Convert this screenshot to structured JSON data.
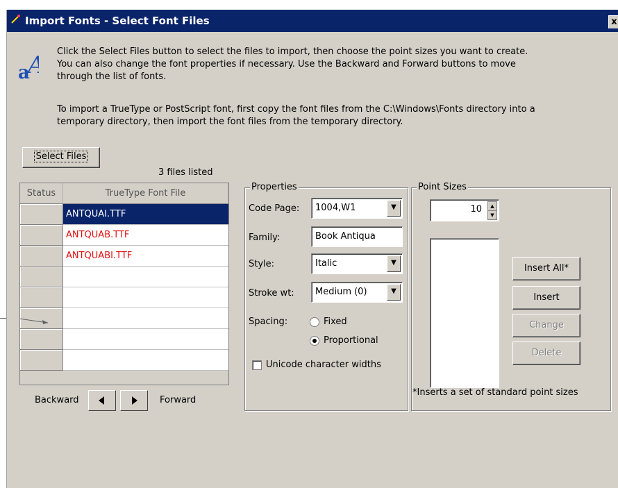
{
  "window": {
    "title": "Import Fonts - Select Font Files",
    "close_label": "x"
  },
  "instructions": {
    "line1": "Click the Select Files button to select the files to import, then choose the point sizes you want to create.",
    "line2": "You can also change the font properties if necessary. Use the Backward and Forward buttons to move",
    "line3": "through the list of fonts.",
    "line4": "To import a TrueType or PostScript font, first copy the font files from the C:\\Windows\\Fonts directory into a",
    "line5": "temporary directory, then import the font files from the temporary directory."
  },
  "select_files_label": "Select Files",
  "files_count": "3 files listed",
  "table": {
    "columns": [
      "Status",
      "TrueType Font File"
    ],
    "rows": [
      "ANTQUAI.TTF",
      "ANTQUAB.TTF",
      "ANTQUABI.TTF",
      "",
      "",
      "",
      "",
      ""
    ]
  },
  "navigation": {
    "backward_label": "Backward",
    "forward_label": "Forward"
  },
  "properties": {
    "group_label": "Properties",
    "code_page_label": "Code Page:",
    "code_page_value": "1004,W1",
    "family_label": "Family:",
    "family_value": "Book Antiqua",
    "style_label": "Style:",
    "style_value": "Italic",
    "stroke_label": "Stroke wt:",
    "stroke_value": "Medium (0)",
    "spacing_label": "Spacing:",
    "fixed_label": "Fixed",
    "proportional_label": "Proportional",
    "spacing_selected": "Proportional",
    "unicode_label": "Unicode character widths",
    "unicode_checked": false
  },
  "point_sizes": {
    "group_label": "Point Sizes",
    "value": "10",
    "insert_all_label": "Insert All*",
    "insert_label": "Insert",
    "change_label": "Change",
    "delete_label": "Delete",
    "footnote": "*Inserts a set of standard point sizes"
  },
  "colors": {
    "titlebar": "#0a246a",
    "selection": "#0a246a",
    "missing_file": "#e01010",
    "dialog_bg": "#d4d0c8"
  }
}
